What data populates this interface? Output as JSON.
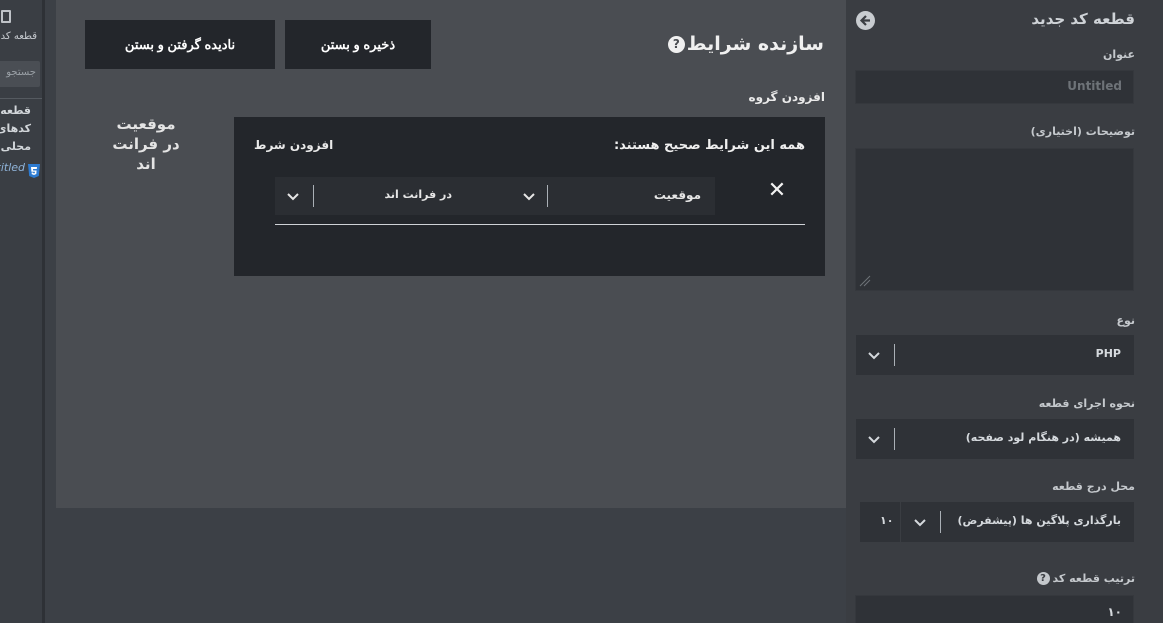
{
  "left_panel": {
    "title": "قطعه کد",
    "search_placeholder": "جستجو",
    "items": [
      "قطعه",
      "کدهای",
      "محلی",
      "Untitled"
    ]
  },
  "modal": {
    "title": "سازنده شرایط",
    "save_close": "ذخیره و بستن",
    "ignore_close": "نادیده گرفتن و بستن",
    "add_group": "افزودن گروه",
    "preview_text": "موقعیت در فرانت اند",
    "group": {
      "title": "همه این شرایط صحیح هستند:",
      "add_condition": "افزودن شرط",
      "condition": {
        "field": "موقعیت",
        "value": "در فرانت اند",
        "remove_symbol": "✕"
      }
    }
  },
  "sidebar": {
    "title": "قطعه کد جدید",
    "title_label": "عنوان",
    "title_placeholder": "Untitled",
    "description_label": "توضیحات (اختیاری)",
    "type_label": "نوع",
    "type_value": "PHP",
    "run_label": "نحوه اجرای قطعه",
    "run_value": "همیشه (در هنگام لود صفحه)",
    "location_label": "محل درج قطعه",
    "location_value": "بارگذاری پلاگین ها (پیشفرض)",
    "location_priority": "۱۰",
    "order_label": "ترتیب قطعه کد",
    "order_value": "۱۰"
  },
  "colors": {
    "background": "#3c4046",
    "modal": "#4a4d52",
    "dark_panel": "#23262b",
    "sidebar": "#3a3d42"
  }
}
